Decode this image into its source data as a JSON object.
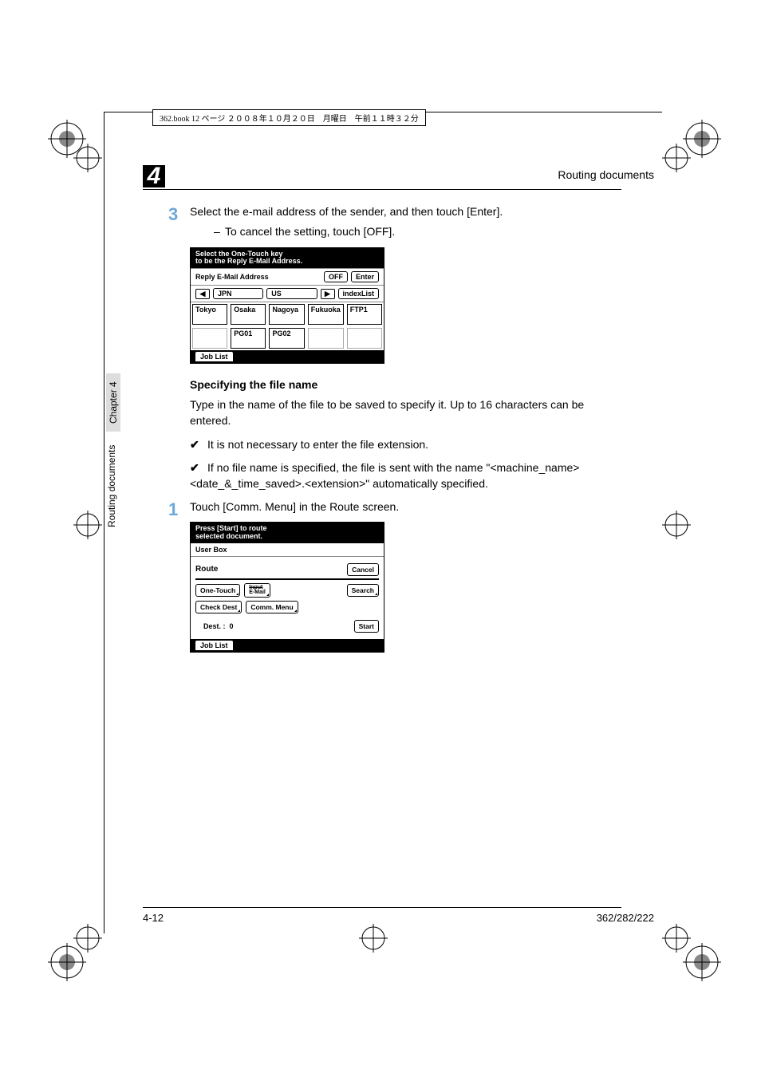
{
  "book_strip": "362.book  12 ページ  ２００８年１０月２０日　月曜日　午前１１時３２分",
  "header": {
    "chapter_num": "4",
    "title": "Routing documents"
  },
  "side": {
    "chapter": "Chapter 4",
    "title": "Routing documents"
  },
  "step3": {
    "num": "3",
    "text": "Select the e-mail address of the sender, and then touch [Enter].",
    "sub": "To cancel the setting, touch [OFF]."
  },
  "screen1": {
    "title_l1": "Select the One-Touch key",
    "title_l2": "to be the Reply E-Mail Address.",
    "reply_label": "Reply E-Mail Address",
    "off": "OFF",
    "enter": "Enter",
    "jpn": "JPN",
    "us": "US",
    "indexlist": "indexList",
    "cells": [
      "Tokyo",
      "Osaka",
      "Nagoya",
      "Fukuoka",
      "FTP1",
      "",
      "PG01",
      "PG02",
      "",
      ""
    ],
    "joblist": "Job List"
  },
  "section": {
    "heading": "Specifying the file name",
    "para": "Type in the name of the file to be saved to specify it. Up to 16 characters can be entered.",
    "b1": "It is not necessary to enter the file extension.",
    "b2": "If no file name is specified, the file is sent with the name \"<machine_name><date_&_time_saved>.<extension>\" automatically specified."
  },
  "step1": {
    "num": "1",
    "text": "Touch [Comm. Menu] in the Route screen."
  },
  "screen2": {
    "title_l1": "Press [Start] to route",
    "title_l2": "selected document.",
    "userbox": "User Box",
    "route": "Route",
    "cancel": "Cancel",
    "onetouch": "One-Touch",
    "email": "Input E-Mail",
    "search": "Search",
    "checkdest": "Check Dest",
    "commmenu": "Comm. Menu",
    "dest_label": "Dest.  :",
    "dest_val": "0",
    "start": "Start",
    "joblist": "Job List"
  },
  "footer": {
    "left": "4-12",
    "right": "362/282/222"
  }
}
